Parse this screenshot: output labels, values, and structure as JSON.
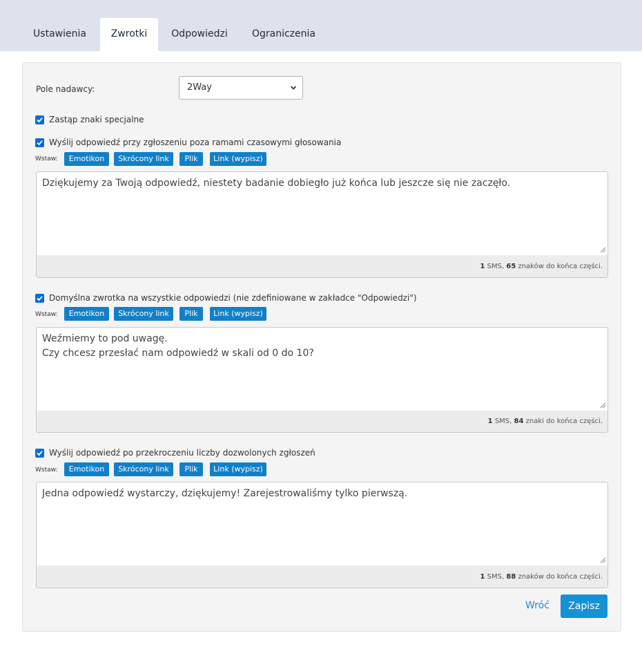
{
  "tabs": [
    {
      "label": "Ustawienia",
      "active": false
    },
    {
      "label": "Zwrotki",
      "active": true
    },
    {
      "label": "Odpowiedzi",
      "active": false
    },
    {
      "label": "Ograniczenia",
      "active": false
    }
  ],
  "sender": {
    "label": "Pole nadawcy:",
    "value": "2Way"
  },
  "replace_special": {
    "label": "Zastąp znaki specjalne",
    "checked": true
  },
  "insert_label": "Wstaw:",
  "insert_buttons": [
    "Emotikon",
    "Skrócony link",
    "Plik",
    "Link (wypisz)"
  ],
  "sections": [
    {
      "checkbox_label": "Wyślij odpowiedź przy zgłoszeniu poza ramami czasowymi głosowania",
      "checked": true,
      "message": "Dziękujemy za Twoją odpowiedź, niestety badanie dobiegło już końca lub jeszcze się nie zaczęło.",
      "sms_count": "1",
      "sms_word": "SMS,",
      "chars_left": "65",
      "chars_text": "znaków do końca części."
    },
    {
      "checkbox_label": "Domyślna zwrotka na wszystkie odpowiedzi (nie zdefiniowane w zakładce \"Odpowiedzi\")",
      "checked": true,
      "message": "Weźmiemy to pod uwagę.\nCzy chcesz przesłać nam odpowiedź w skali od 0 do 10?",
      "sms_count": "1",
      "sms_word": "SMS,",
      "chars_left": "84",
      "chars_text": "znaki do końca części."
    },
    {
      "checkbox_label": "Wyślij odpowiedź po przekroczeniu liczby dozwolonych zgłoszeń",
      "checked": true,
      "message": "Jedna odpowiedź wystarczy, dziękujemy! Zarejestrowaliśmy tylko pierwszą.",
      "sms_count": "1",
      "sms_word": "SMS,",
      "chars_left": "88",
      "chars_text": "znaków do końca części."
    }
  ],
  "actions": {
    "back": "Wróć",
    "save": "Zapisz"
  },
  "colors": {
    "accent": "#1280c8",
    "tabbar": "#dde2ed",
    "link": "#1f8bd0"
  }
}
